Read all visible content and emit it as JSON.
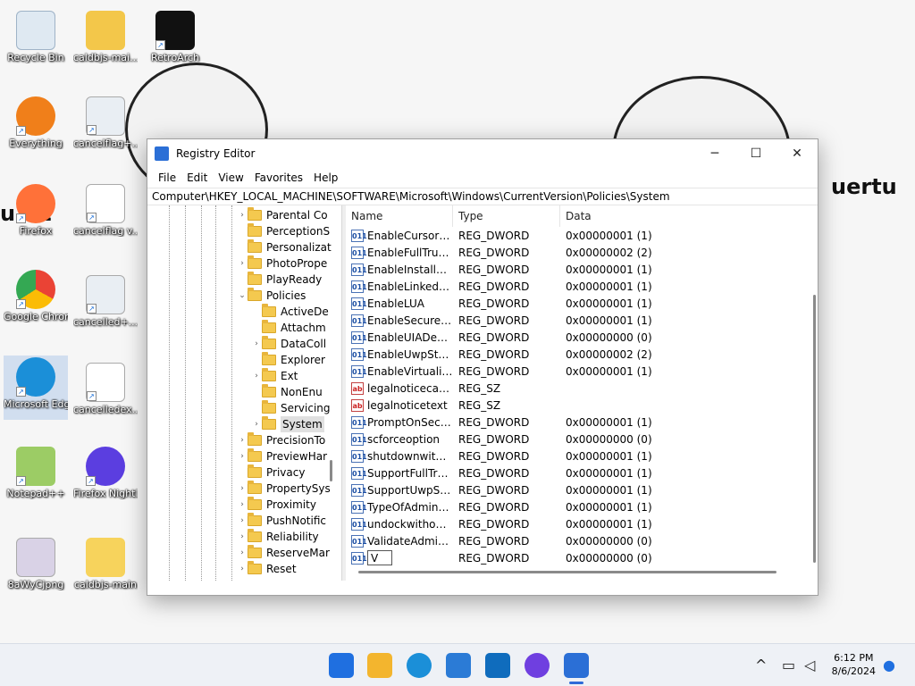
{
  "desktop": {
    "wallpaper_text": "uertu",
    "wallpaper_text_left": "u  72",
    "icons": [
      {
        "label": "Recycle Bin"
      },
      {
        "label": "caldbjs-mai..."
      },
      {
        "label": "RetroArch"
      },
      {
        "label": "Everything"
      },
      {
        "label": "cancelflag+..."
      },
      {
        "label": "Firefox"
      },
      {
        "label": "cancelflag v..."
      },
      {
        "label": "Google Chrome"
      },
      {
        "label": "cancelled+..."
      },
      {
        "label": "Microsoft Edge"
      },
      {
        "label": "cancelledex..."
      },
      {
        "label": "Notepad++"
      },
      {
        "label": "Firefox Nightly"
      },
      {
        "label": "8aWyCjpng"
      },
      {
        "label": "caldbjs-main"
      }
    ]
  },
  "window": {
    "title": "Registry Editor",
    "minimize": "─",
    "maximize": "☐",
    "close": "✕",
    "menu": [
      "File",
      "Edit",
      "View",
      "Favorites",
      "Help"
    ],
    "address": "Computer\\HKEY_LOCAL_MACHINE\\SOFTWARE\\Microsoft\\Windows\\CurrentVersion\\Policies\\System"
  },
  "tree": [
    {
      "label": "Parental Co",
      "arrow": "›",
      "level": 0
    },
    {
      "label": "PerceptionS",
      "arrow": "",
      "level": 0
    },
    {
      "label": "Personalizat",
      "arrow": "",
      "level": 0
    },
    {
      "label": "PhotoPrope",
      "arrow": "›",
      "level": 0
    },
    {
      "label": "PlayReady",
      "arrow": "",
      "level": 0
    },
    {
      "label": "Policies",
      "arrow": "⌄",
      "level": 0
    },
    {
      "label": "ActiveDe",
      "arrow": "",
      "level": 1
    },
    {
      "label": "Attachm",
      "arrow": "",
      "level": 1
    },
    {
      "label": "DataColl",
      "arrow": "›",
      "level": 1
    },
    {
      "label": "Explorer",
      "arrow": "",
      "level": 1
    },
    {
      "label": "Ext",
      "arrow": "›",
      "level": 1
    },
    {
      "label": "NonEnu",
      "arrow": "",
      "level": 1
    },
    {
      "label": "Servicing",
      "arrow": "",
      "level": 1
    },
    {
      "label": "System",
      "arrow": "›",
      "level": 1,
      "selected": true
    },
    {
      "label": "PrecisionTo",
      "arrow": "›",
      "level": 0
    },
    {
      "label": "PreviewHar",
      "arrow": "›",
      "level": 0
    },
    {
      "label": "Privacy",
      "arrow": "",
      "level": 0
    },
    {
      "label": "PropertySys",
      "arrow": "›",
      "level": 0
    },
    {
      "label": "Proximity",
      "arrow": "›",
      "level": 0
    },
    {
      "label": "PushNotific",
      "arrow": "›",
      "level": 0
    },
    {
      "label": "Reliability",
      "arrow": "›",
      "level": 0
    },
    {
      "label": "ReserveMar",
      "arrow": "›",
      "level": 0
    },
    {
      "label": "Reset",
      "arrow": "›",
      "level": 0
    }
  ],
  "list": {
    "headers": {
      "name": "Name",
      "type": "Type",
      "data": "Data"
    },
    "rows": [
      {
        "icon": "011",
        "name": "EnableCursorSu...",
        "type": "REG_DWORD",
        "data": "0x00000001 (1)"
      },
      {
        "icon": "011",
        "name": "EnableFullTrustS...",
        "type": "REG_DWORD",
        "data": "0x00000002 (2)"
      },
      {
        "icon": "011",
        "name": "EnableInstallerD...",
        "type": "REG_DWORD",
        "data": "0x00000001 (1)"
      },
      {
        "icon": "011",
        "name": "EnableLinkedCo...",
        "type": "REG_DWORD",
        "data": "0x00000001 (1)"
      },
      {
        "icon": "011",
        "name": "EnableLUA",
        "type": "REG_DWORD",
        "data": "0x00000001 (1)"
      },
      {
        "icon": "011",
        "name": "EnableSecureUI...",
        "type": "REG_DWORD",
        "data": "0x00000001 (1)"
      },
      {
        "icon": "011",
        "name": "EnableUIADeskt...",
        "type": "REG_DWORD",
        "data": "0x00000000 (0)"
      },
      {
        "icon": "011",
        "name": "EnableUwpStart...",
        "type": "REG_DWORD",
        "data": "0x00000002 (2)"
      },
      {
        "icon": "011",
        "name": "EnableVirtualizat...",
        "type": "REG_DWORD",
        "data": "0x00000001 (1)"
      },
      {
        "icon": "ab",
        "name": "legalnoticecapti...",
        "type": "REG_SZ",
        "data": ""
      },
      {
        "icon": "ab",
        "name": "legalnoticetext",
        "type": "REG_SZ",
        "data": ""
      },
      {
        "icon": "011",
        "name": "PromptOnSecur...",
        "type": "REG_DWORD",
        "data": "0x00000001 (1)"
      },
      {
        "icon": "011",
        "name": "scforceoption",
        "type": "REG_DWORD",
        "data": "0x00000000 (0)"
      },
      {
        "icon": "011",
        "name": "shutdownwitho...",
        "type": "REG_DWORD",
        "data": "0x00000001 (1)"
      },
      {
        "icon": "011",
        "name": "SupportFullTrust...",
        "type": "REG_DWORD",
        "data": "0x00000001 (1)"
      },
      {
        "icon": "011",
        "name": "SupportUwpStar...",
        "type": "REG_DWORD",
        "data": "0x00000001 (1)"
      },
      {
        "icon": "011",
        "name": "TypeOfAdminA...",
        "type": "REG_DWORD",
        "data": "0x00000001 (1)"
      },
      {
        "icon": "011",
        "name": "undockwithoutl...",
        "type": "REG_DWORD",
        "data": "0x00000001 (1)"
      },
      {
        "icon": "011",
        "name": "ValidateAdminC...",
        "type": "REG_DWORD",
        "data": "0x00000000 (0)"
      }
    ],
    "editing_row": {
      "icon": "011",
      "value": "V",
      "type": "REG_DWORD",
      "data": "0x00000000 (0)"
    }
  },
  "taskbar": {
    "time": "6:12 PM",
    "date": "8/6/2024",
    "chevron": "^",
    "colors": {
      "start": "#1f6fe0",
      "explorer": "#f3b52e",
      "edge": "#1b8fd8",
      "store": "#2b7bd6",
      "outlook": "#0f6cbd",
      "firefox": "#6f3fe0",
      "regedit": "#2b6fd6"
    }
  }
}
